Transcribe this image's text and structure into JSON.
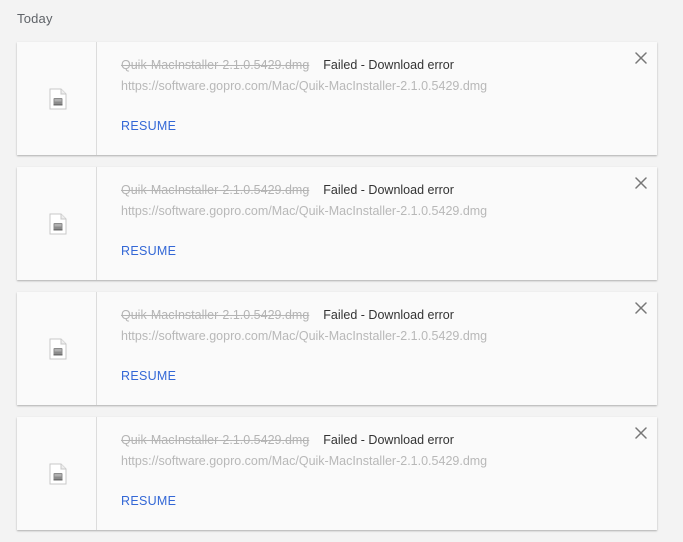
{
  "section": {
    "title": "Today"
  },
  "downloads": [
    {
      "filename": "Quik-MacInstaller-2.1.0.5429.dmg",
      "status": "Failed - Download error",
      "url": "https://software.gopro.com/Mac/Quik-MacInstaller-2.1.0.5429.dmg",
      "action_label": "RESUME",
      "icon": "file-icon",
      "close_icon": "close-icon"
    },
    {
      "filename": "Quik-MacInstaller-2.1.0.5429.dmg",
      "status": "Failed - Download error",
      "url": "https://software.gopro.com/Mac/Quik-MacInstaller-2.1.0.5429.dmg",
      "action_label": "RESUME",
      "icon": "file-icon",
      "close_icon": "close-icon"
    },
    {
      "filename": "Quik-MacInstaller-2.1.0.5429.dmg",
      "status": "Failed - Download error",
      "url": "https://software.gopro.com/Mac/Quik-MacInstaller-2.1.0.5429.dmg",
      "action_label": "RESUME",
      "icon": "file-icon",
      "close_icon": "close-icon"
    },
    {
      "filename": "Quik-MacInstaller-2.1.0.5429.dmg",
      "status": "Failed - Download error",
      "url": "https://software.gopro.com/Mac/Quik-MacInstaller-2.1.0.5429.dmg",
      "action_label": "RESUME",
      "icon": "file-icon",
      "close_icon": "close-icon"
    }
  ],
  "colors": {
    "accent": "#3367d6",
    "status_text": "#333333",
    "muted_text": "#b4b4b4",
    "background": "#f3f3f3",
    "card": "#fafafa"
  }
}
